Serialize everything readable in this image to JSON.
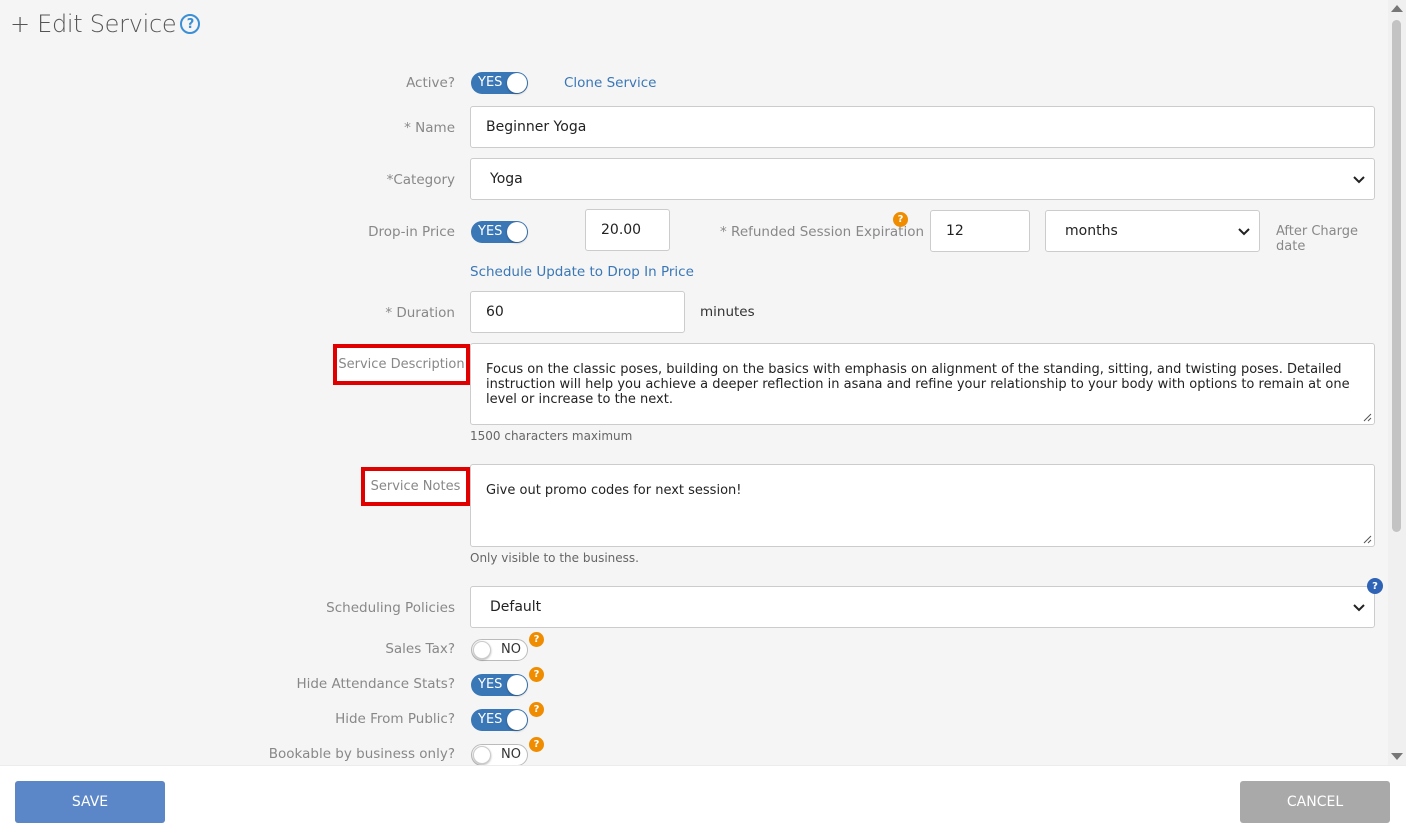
{
  "header": {
    "title": "+ Edit Service",
    "help_icon": "question-circle-icon"
  },
  "active": {
    "label": "Active?",
    "toggle": "YES",
    "clone_link": "Clone Service"
  },
  "name": {
    "label": "* Name",
    "value": "Beginner Yoga"
  },
  "category": {
    "label": "*Category",
    "value": "Yoga"
  },
  "dropin": {
    "label": "Drop-in Price",
    "toggle": "YES",
    "price": "20.00",
    "refund_label": "* Refunded Session Expiration",
    "refund_value": "12",
    "refund_unit": "months",
    "after_label": "After Charge date",
    "schedule_link": "Schedule Update to Drop In Price"
  },
  "duration": {
    "label": "* Duration",
    "value": "60",
    "unit": "minutes"
  },
  "description": {
    "label": "Service Description",
    "value": "Focus on the classic poses, building on the basics with emphasis on alignment of the standing, sitting, and twisting poses. Detailed instruction will help you achieve a deeper reflection in asana and refine your relationship to your body with options to remain at one level or increase to the next.",
    "hint": "1500 characters maximum"
  },
  "notes": {
    "label": "Service Notes",
    "value": "Give out promo codes for next session!",
    "hint": "Only visible to the business."
  },
  "scheduling": {
    "label": "Scheduling Policies",
    "value": "Default"
  },
  "sales_tax": {
    "label": "Sales Tax?",
    "toggle": "NO"
  },
  "hide_stats": {
    "label": "Hide Attendance Stats?",
    "toggle": "YES"
  },
  "hide_public": {
    "label": "Hide From Public?",
    "toggle": "YES"
  },
  "bookable": {
    "label": "Bookable by business only?",
    "toggle": "NO"
  },
  "footer": {
    "save": "SAVE",
    "cancel": "CANCEL"
  },
  "colors": {
    "toggle_on": "#3a77b7",
    "link": "#3a77b7",
    "save_button": "#5b86c7",
    "cancel_button": "#a9a9a9",
    "highlight_box": "#e00000",
    "help_badge": "#f08c00"
  }
}
